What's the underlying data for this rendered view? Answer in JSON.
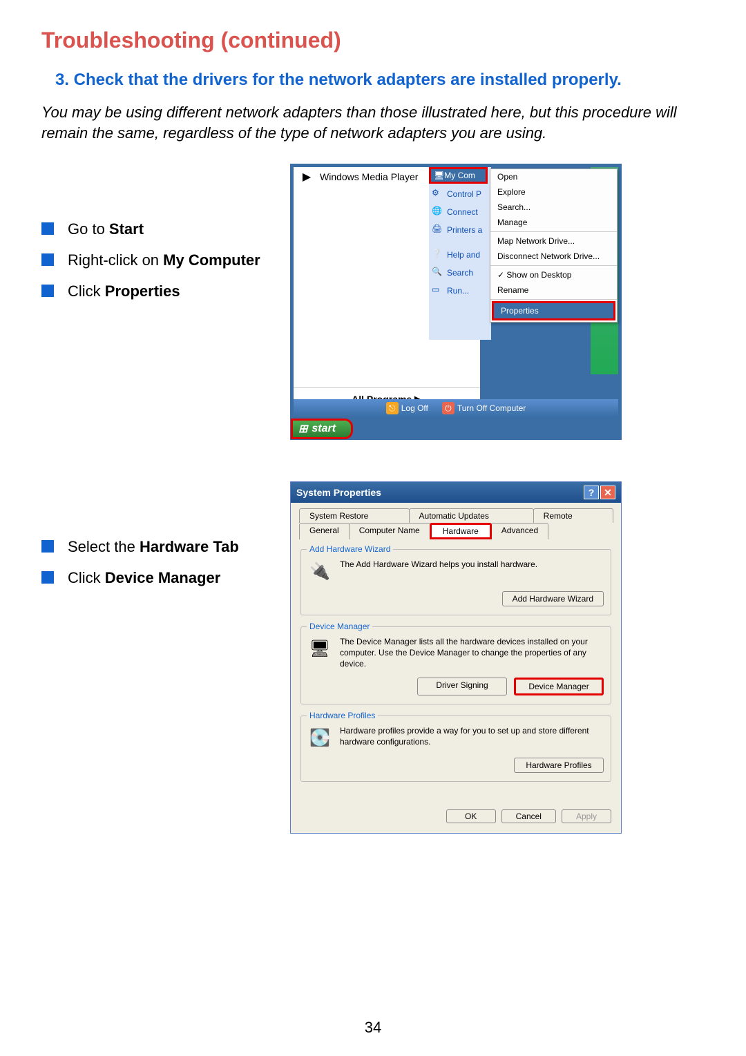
{
  "page": {
    "title": "Troubleshooting (continued)",
    "section_heading": "3.  Check that the drivers for the network adapters are installed properly.",
    "intro": "You may be using different network adapters than those illustrated here, but this procedure will remain the same, regardless of the type of network adapters you are using.",
    "page_number": "34"
  },
  "instructions1": [
    {
      "pre": "Go to ",
      "bold": "Start"
    },
    {
      "pre": "Right-click on ",
      "bold": "My Computer"
    },
    {
      "pre": "Click ",
      "bold": "Properties"
    }
  ],
  "instructions2": [
    {
      "pre": "Select the ",
      "bold": "Hardware Tab"
    },
    {
      "pre": "Click ",
      "bold": "Device Manager"
    }
  ],
  "start_menu": {
    "wmp": "Windows Media Player",
    "all_programs": "All Programs",
    "my_computer_short": "My Com",
    "blue_items": [
      "Control P",
      "Connect",
      "Printers a",
      "Help and",
      "Search",
      "Run..."
    ],
    "context": {
      "open": "Open",
      "explore": "Explore",
      "search": "Search...",
      "manage": "Manage",
      "map": "Map Network Drive...",
      "disconnect": "Disconnect Network Drive...",
      "show": "Show on Desktop",
      "rename": "Rename",
      "properties": "Properties"
    },
    "log_off": "Log Off",
    "turn_off": "Turn Off Computer",
    "start": "start"
  },
  "sysprops": {
    "title": "System Properties",
    "tabs_row1": [
      "System Restore",
      "Automatic Updates",
      "Remote"
    ],
    "tabs_row2": [
      "General",
      "Computer Name",
      "Hardware",
      "Advanced"
    ],
    "groups": {
      "add_hw": {
        "title": "Add Hardware Wizard",
        "text": "The Add Hardware Wizard helps you install hardware.",
        "button": "Add Hardware Wizard"
      },
      "dev_mgr": {
        "title": "Device Manager",
        "text": "The Device Manager lists all the hardware devices installed on your computer. Use the Device Manager to change the properties of any device.",
        "btn_sign": "Driver Signing",
        "btn_devmgr": "Device Manager"
      },
      "hw_profiles": {
        "title": "Hardware Profiles",
        "text": "Hardware profiles provide a way for you to set up and store different hardware configurations.",
        "button": "Hardware Profiles"
      }
    },
    "footer": {
      "ok": "OK",
      "cancel": "Cancel",
      "apply": "Apply"
    }
  }
}
